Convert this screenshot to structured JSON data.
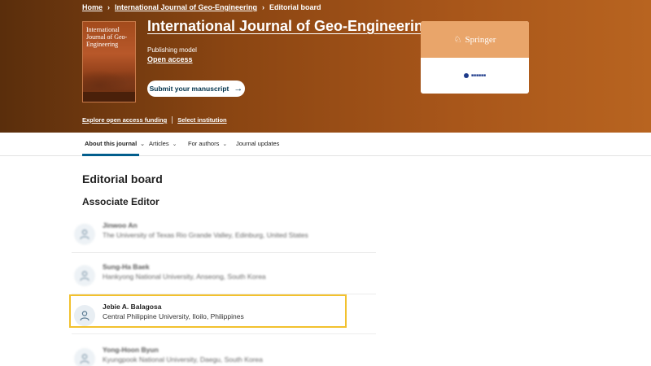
{
  "breadcrumb": {
    "home": "Home",
    "journal": "International Journal of Geo-Engineering",
    "current": "Editorial board",
    "separator": "›"
  },
  "journal": {
    "cover_title": "International Journal of Geo-Engineering",
    "title": "International Journal of Geo-Engineering",
    "publishing_model_label": "Publishing model",
    "publishing_model_value": "Open access",
    "submit_label": "Submit your manuscript",
    "publisher": "Springer"
  },
  "funding": {
    "explore": "Explore open access funding",
    "select": "Select institution"
  },
  "nav": {
    "items": [
      {
        "label": "About this journal",
        "has_dropdown": true,
        "active": true
      },
      {
        "label": "Articles",
        "has_dropdown": true,
        "active": false
      },
      {
        "label": "For authors",
        "has_dropdown": true,
        "active": false
      },
      {
        "label": "Journal updates",
        "has_dropdown": false,
        "active": false
      }
    ]
  },
  "page": {
    "heading": "Editorial board",
    "section": "Associate Editor"
  },
  "members": [
    {
      "name": "Jinwoo An",
      "affiliation": "The University of Texas Rio Grande Valley, Edinburg, United States",
      "blurred": true
    },
    {
      "name": "Sung-Ha Baek",
      "affiliation": "Hankyong National University, Anseong, South Korea",
      "blurred": true
    },
    {
      "name": "Jebie A. Balagosa",
      "affiliation": "Central Philippine University, Iloilo, Philippines",
      "blurred": false,
      "highlighted": true
    },
    {
      "name": "Yong-Hoon Byun",
      "affiliation": "Kyungpook National University, Daegu, South Korea",
      "blurred": true
    }
  ],
  "colors": {
    "header_dark": "#5a2e0c",
    "header_light": "#b86420",
    "accent": "#025e8d",
    "highlight": "#f2c12e"
  },
  "icons": {
    "avatar": "person-icon",
    "chevron": "chevron-down-icon",
    "arrow": "arrow-right-icon",
    "publisher": "springer-horse-icon"
  }
}
